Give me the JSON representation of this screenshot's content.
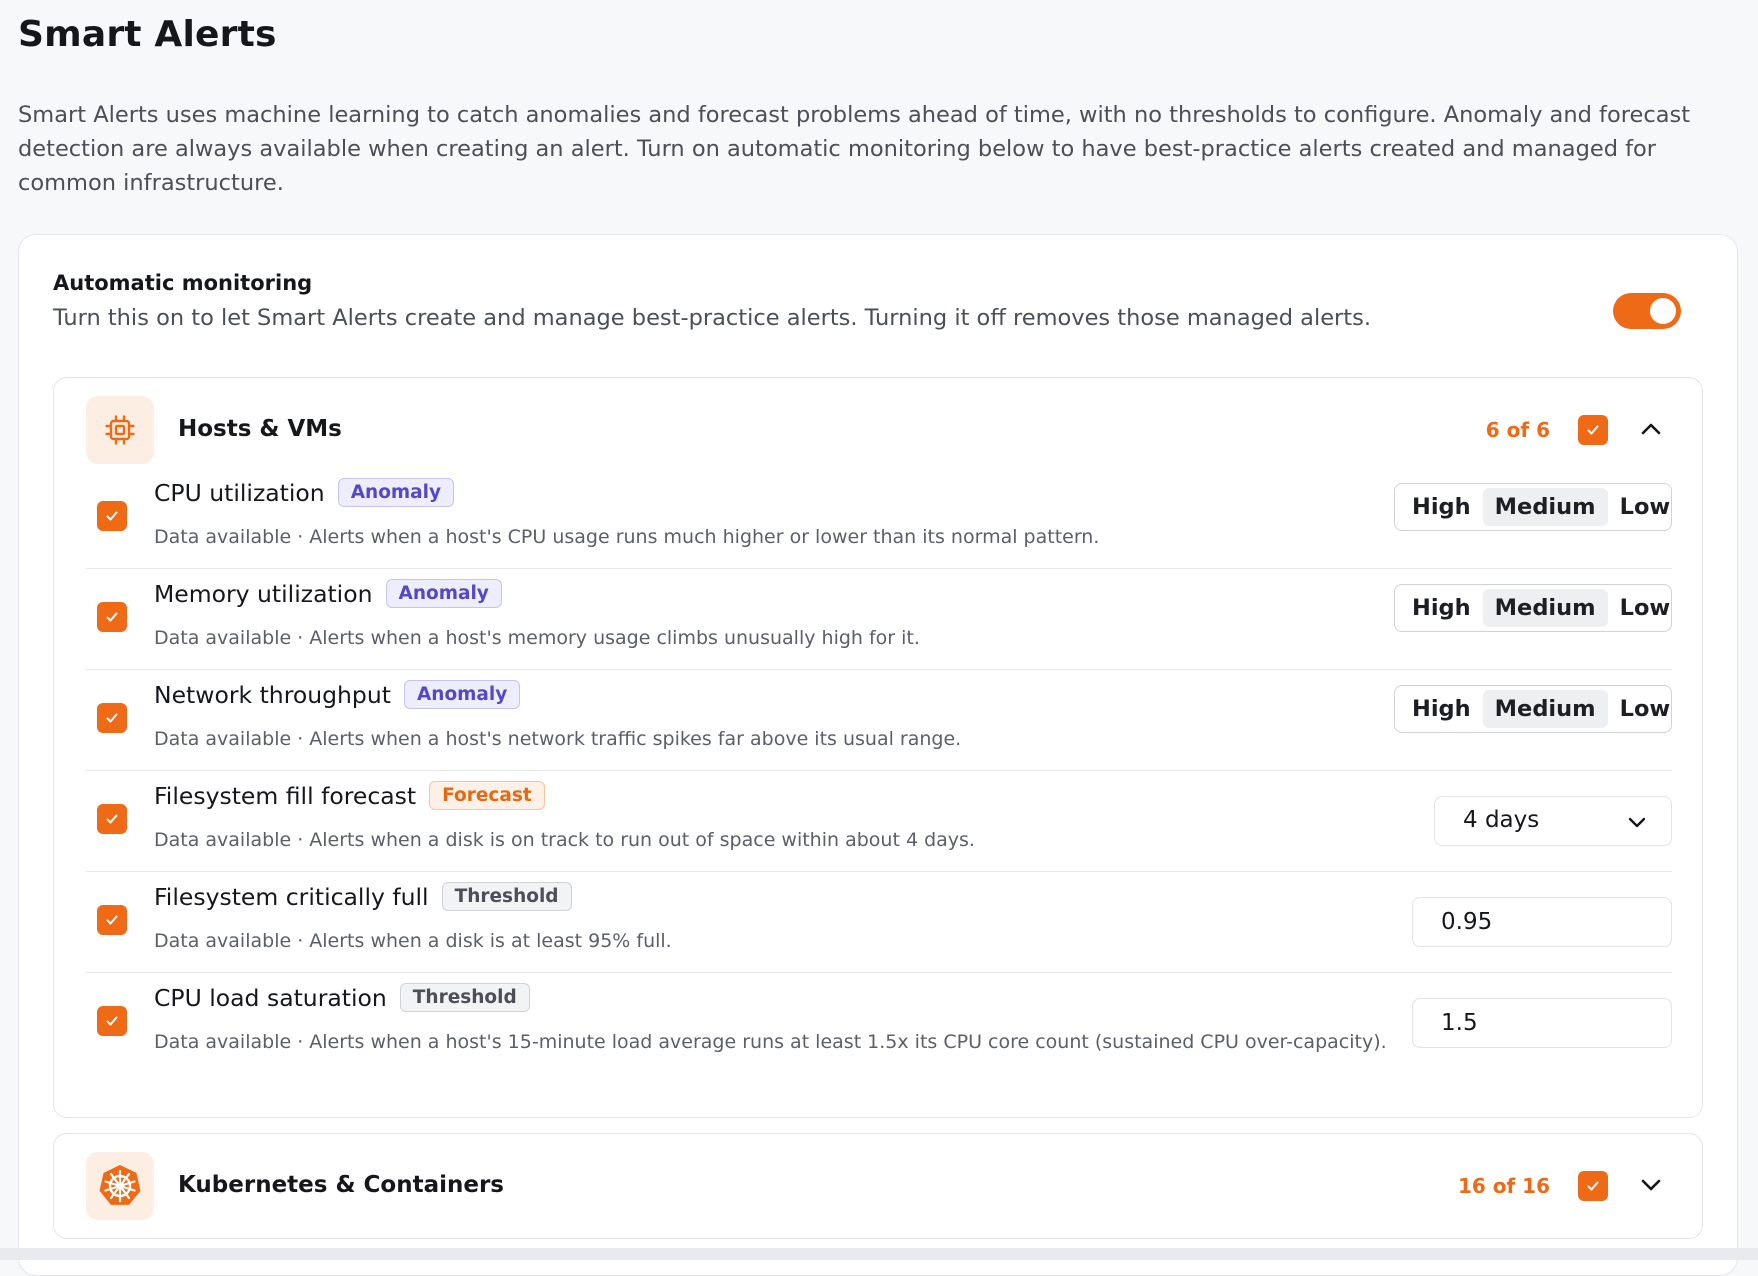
{
  "page": {
    "title": "Smart Alerts",
    "intro": "Smart Alerts uses machine learning to catch anomalies and forecast problems ahead of time, with no thresholds to configure. Anomaly and forecast detection are always available when creating an alert. Turn on automatic monitoring below to have best-practice alerts created and managed for common infrastructure."
  },
  "automatic_monitoring": {
    "title": "Automatic monitoring",
    "description": "Turn this on to let Smart Alerts create and manage best-practice alerts. Turning it off removes those managed alerts.",
    "enabled": true
  },
  "colors": {
    "accent": "#ee6a16",
    "anomaly_badge": "#5548c8",
    "forecast_badge": "#e26a16",
    "threshold_badge": "#4b4f57"
  },
  "groups": [
    {
      "title": "Hosts & VMs",
      "icon": "cpu-chip-icon",
      "count": "6 of 6",
      "expanded": true,
      "checked": true,
      "alerts": [
        {
          "name": "CPU utilization",
          "badge": "Anomaly",
          "description": "Data available · Alerts when a host's CPU usage runs much higher or lower than its normal pattern.",
          "sensitivity": [
            "High",
            "Medium",
            "Low"
          ],
          "selected": "Medium"
        },
        {
          "name": "Memory utilization",
          "badge": "Anomaly",
          "description": "Data available · Alerts when a host's memory usage climbs unusually high for it.",
          "sensitivity": [
            "High",
            "Medium",
            "Low"
          ],
          "selected": "Medium"
        },
        {
          "name": "Network throughput",
          "badge": "Anomaly",
          "description": "Data available · Alerts when a host's network traffic spikes far above its usual range.",
          "sensitivity": [
            "High",
            "Medium",
            "Low"
          ],
          "selected": "Medium"
        },
        {
          "name": "Filesystem fill forecast",
          "badge": "Forecast",
          "description": "Data available · Alerts when a disk is on track to run out of space within about 4 days.",
          "value": "4 days"
        },
        {
          "name": "Filesystem critically full",
          "badge": "Threshold",
          "description": "Data available · Alerts when a disk is at least 95% full.",
          "value": "0.95"
        },
        {
          "name": "CPU load saturation",
          "badge": "Threshold",
          "description": "Data available · Alerts when a host's 15-minute load average runs at least 1.5x its CPU core count (sustained CPU over-capacity).",
          "value": "1.5"
        }
      ]
    },
    {
      "title": "Kubernetes & Containers",
      "icon": "kubernetes-helm-icon",
      "count": "16 of 16",
      "expanded": false,
      "checked": true
    }
  ]
}
